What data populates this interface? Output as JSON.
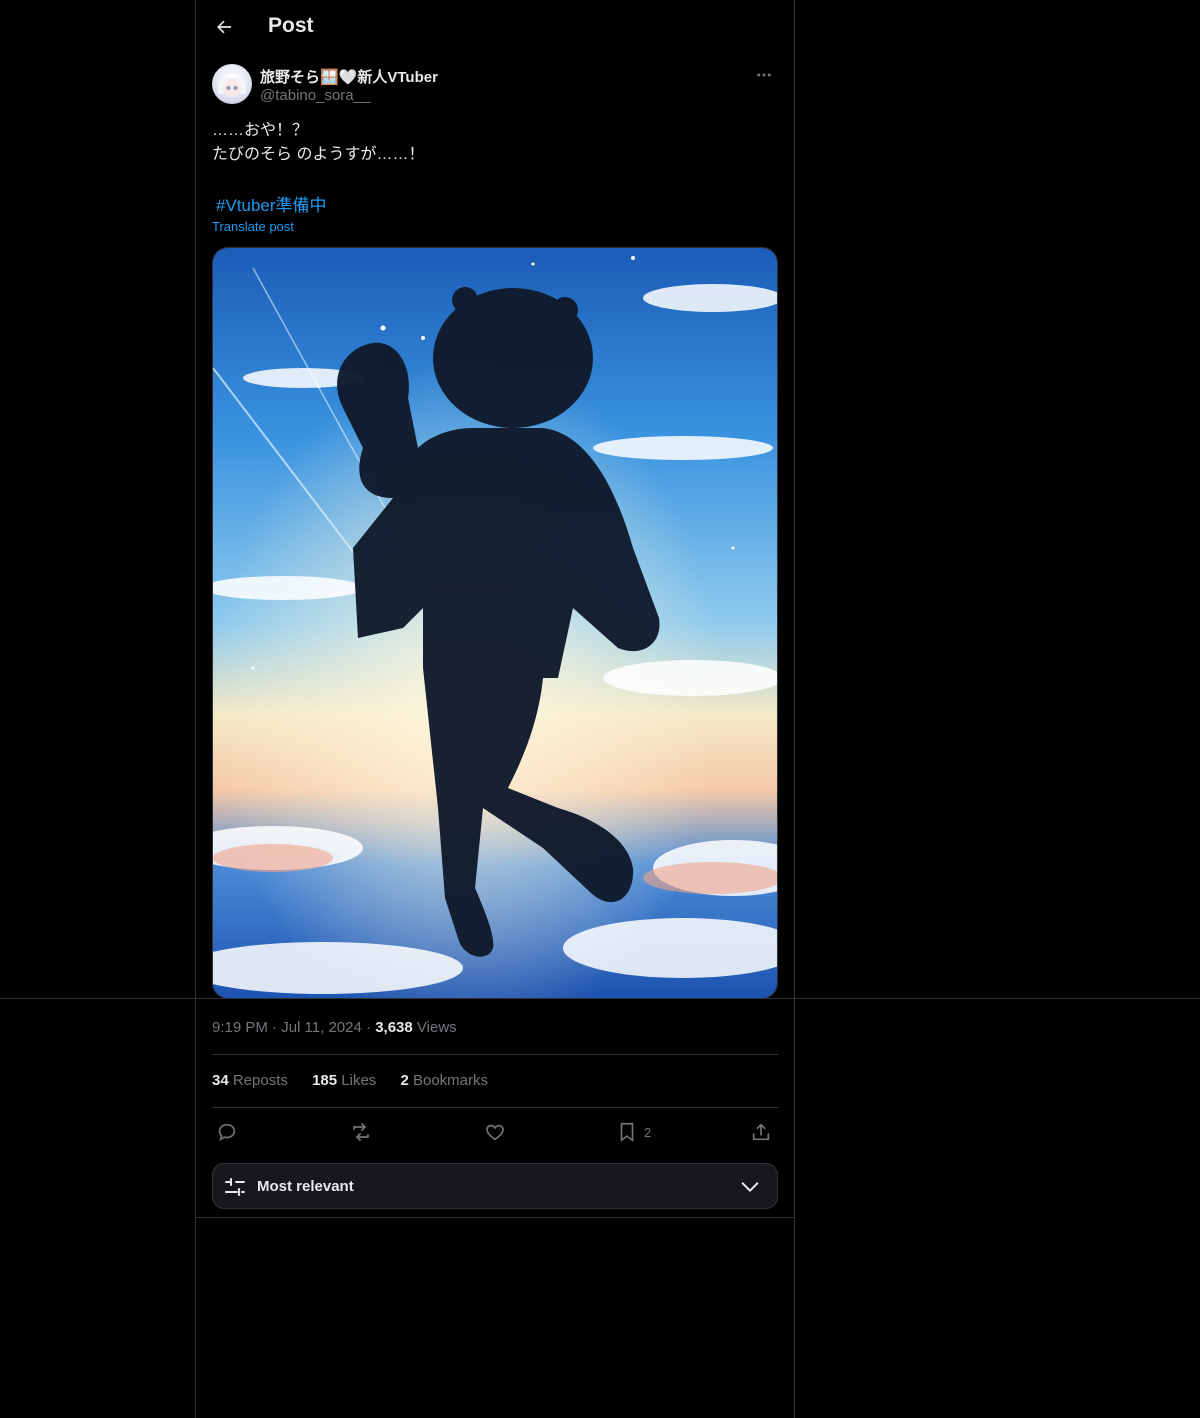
{
  "header": {
    "title": "Post"
  },
  "post": {
    "display_name": "旅野そら🪟🤍新人VTuber",
    "handle": "@tabino_sora__",
    "text": "……おや！？\nたびのそら のようすが……！",
    "hashtag": "#Vtuber準備中",
    "translate_label": "Translate post",
    "time": "9:19 PM",
    "date": "Jul 11, 2024",
    "views_count": "3,638",
    "views_label": "Views"
  },
  "stats": {
    "reposts_count": "34",
    "reposts_label": "Reposts",
    "likes_count": "185",
    "likes_label": "Likes",
    "bookmarks_count": "2",
    "bookmarks_label": "Bookmarks"
  },
  "actions": {
    "bookmark_count": "2"
  },
  "sort": {
    "label": "Most relevant"
  },
  "colors": {
    "accent": "#1d9bf0",
    "muted": "#71767b",
    "border": "#2f3336",
    "background": "#000000"
  },
  "icons": [
    "back-arrow-icon",
    "more-icon",
    "reply-icon",
    "repost-icon",
    "like-icon",
    "bookmark-icon",
    "share-icon",
    "sliders-icon",
    "chevron-down-icon"
  ]
}
